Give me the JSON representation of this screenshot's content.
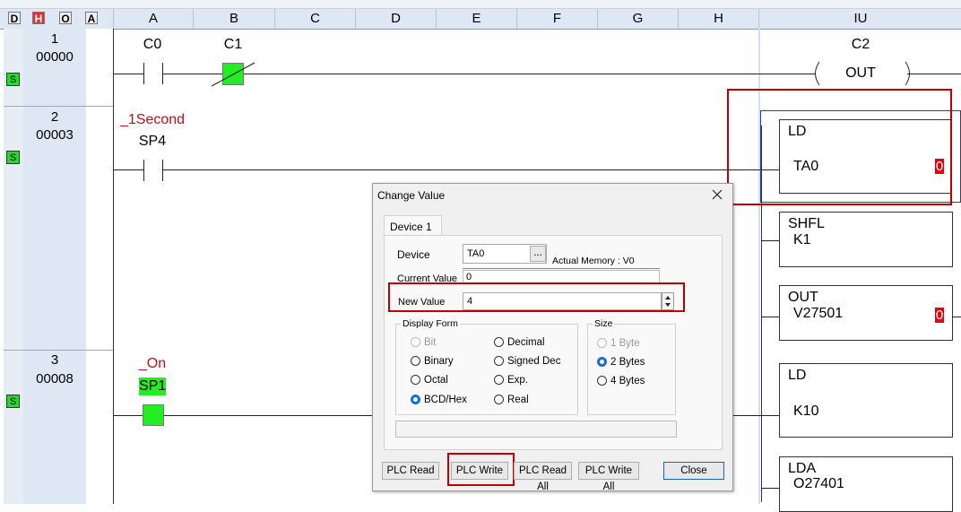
{
  "header": {
    "mode_buttons": [
      "D",
      "H",
      "O",
      "A"
    ],
    "columns": [
      "A",
      "B",
      "C",
      "D",
      "E",
      "F",
      "G",
      "H",
      "IU"
    ]
  },
  "rungs": [
    {
      "number": "1",
      "address": "00000",
      "status": "S"
    },
    {
      "number": "2",
      "address": "00003",
      "status": "S"
    },
    {
      "number": "3",
      "address": "00008",
      "status": "S"
    }
  ],
  "ladder": {
    "r1_contact_a": "C0",
    "r1_contact_b": "C1",
    "r1_coil_name": "C2",
    "r1_coil_label": "OUT",
    "r2_nickname": "_1Second",
    "r2_contact": "SP4",
    "r3_nickname": "_On",
    "r3_contact": "SP1",
    "instr": [
      {
        "op": "LD",
        "arg": "TA0",
        "value": "0"
      },
      {
        "op": "SHFL",
        "arg": "K1"
      },
      {
        "op": "OUT",
        "arg": "V27501",
        "value": "0"
      },
      {
        "op": "LD",
        "arg": "K10"
      },
      {
        "op": "LDA",
        "arg": "O27401"
      }
    ]
  },
  "dialog": {
    "title": "Change Value",
    "tab": "Device 1",
    "device_label": "Device",
    "device_value": "TA0",
    "browse": "...",
    "actual_memory": "Actual Memory : V0",
    "current_label": "Current Value",
    "current_value": "0",
    "new_label": "New Value",
    "new_value": "4",
    "display_form_label": "Display Form",
    "display_form_options": [
      "Bit",
      "Binary",
      "Octal",
      "BCD/Hex",
      "Decimal",
      "Signed Dec",
      "Exp.",
      "Real"
    ],
    "display_form_selected": "BCD/Hex",
    "size_label": "Size",
    "size_options": [
      "1 Byte",
      "2 Bytes",
      "4 Bytes"
    ],
    "size_selected": "2 Bytes",
    "buttons": {
      "plc_read": "PLC Read",
      "plc_write": "PLC Write",
      "plc_read_all": "PLC Read All",
      "plc_write_all": "PLC Write All",
      "close": "Close"
    }
  },
  "colors": {
    "highlight": "#c00000",
    "selection": "#2233dd",
    "power_on": "#22ee22"
  }
}
